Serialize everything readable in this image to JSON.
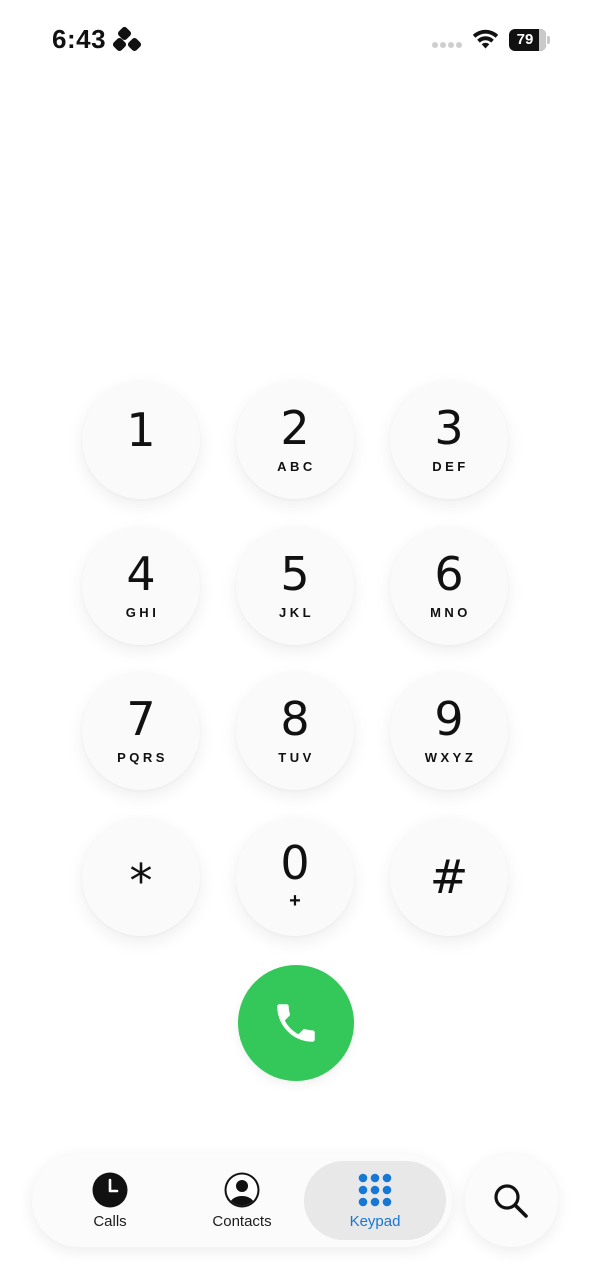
{
  "status_bar": {
    "time": "6:43",
    "battery_level": 79,
    "battery_text": "79",
    "icons": [
      "status-glyph-icon",
      "signal-dots-icon",
      "wifi-icon",
      "battery-icon"
    ]
  },
  "keypad": {
    "keys": [
      {
        "digit": "1",
        "letters": ""
      },
      {
        "digit": "2",
        "letters": "ABC"
      },
      {
        "digit": "3",
        "letters": "DEF"
      },
      {
        "digit": "4",
        "letters": "GHI"
      },
      {
        "digit": "5",
        "letters": "JKL"
      },
      {
        "digit": "6",
        "letters": "MNO"
      },
      {
        "digit": "7",
        "letters": "PQRS"
      },
      {
        "digit": "8",
        "letters": "TUV"
      },
      {
        "digit": "9",
        "letters": "WXYZ"
      },
      {
        "digit": "*",
        "letters": ""
      },
      {
        "digit": "0",
        "letters": "+"
      },
      {
        "digit": "#",
        "letters": ""
      }
    ],
    "call_icon": "phone-icon"
  },
  "tab_bar": {
    "tabs": [
      {
        "label": "Calls",
        "icon": "clock-icon",
        "active": false
      },
      {
        "label": "Contacts",
        "icon": "person-icon",
        "active": false
      },
      {
        "label": "Keypad",
        "icon": "keypad-grid-icon",
        "active": true
      }
    ],
    "search_icon": "search-icon"
  },
  "colors": {
    "call_green": "#34c759",
    "active_tab_blue": "#1777d4",
    "key_background": "#fafafa"
  }
}
